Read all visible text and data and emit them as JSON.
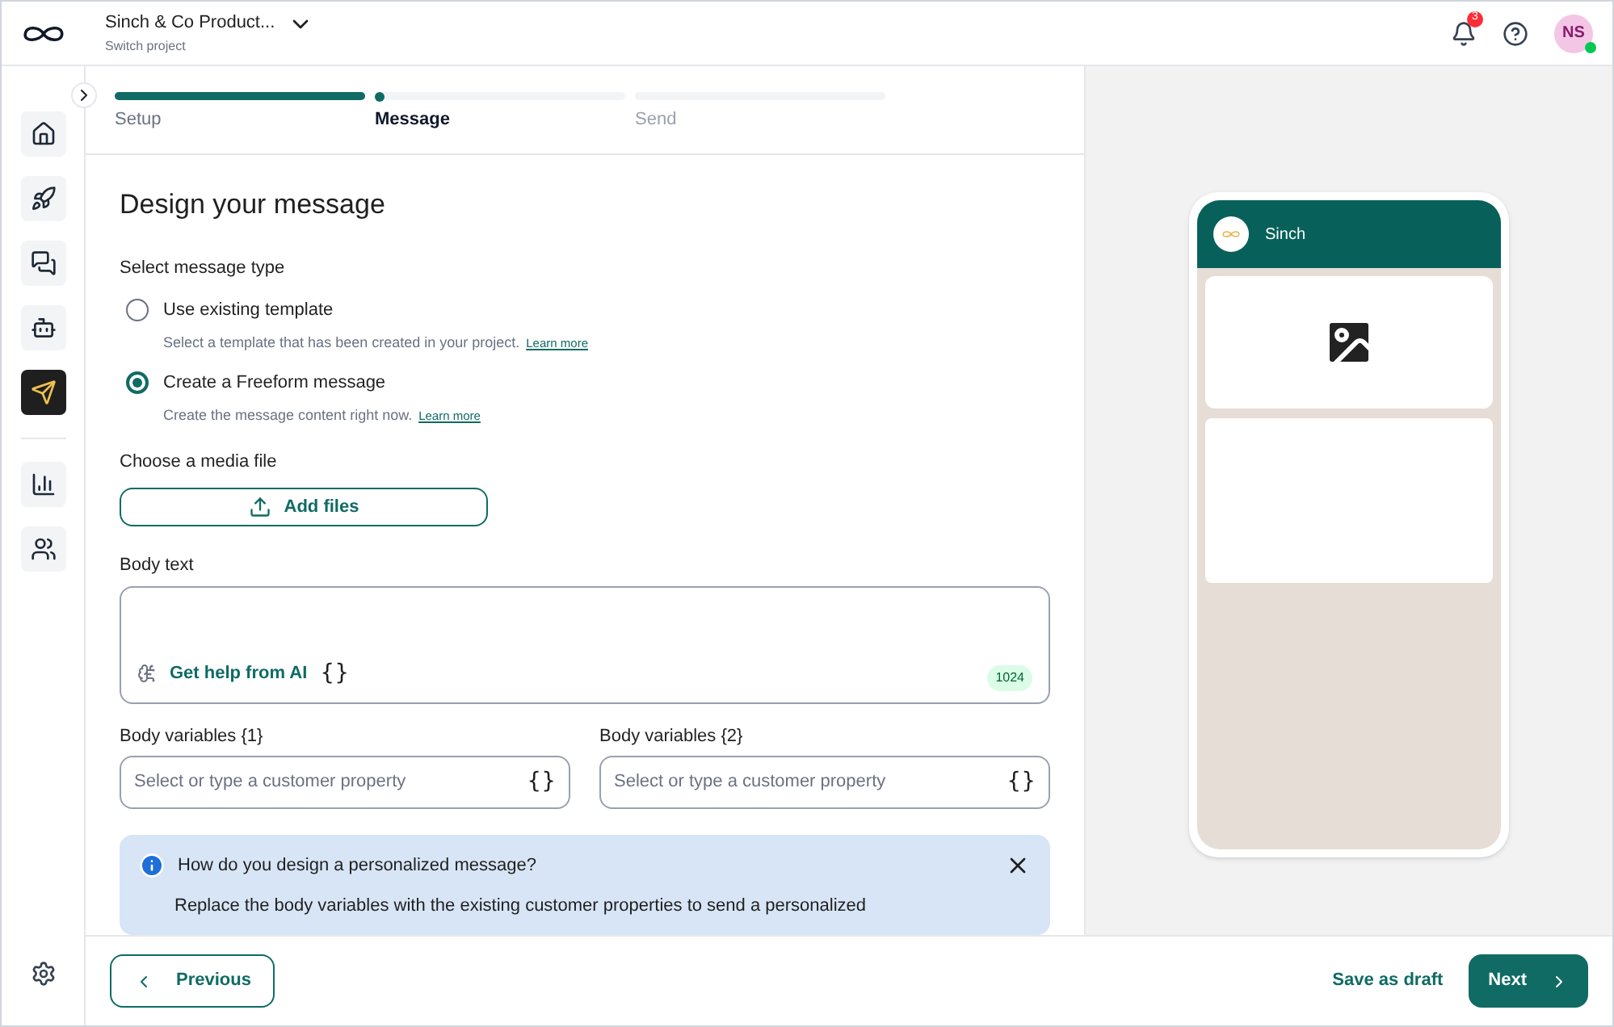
{
  "header": {
    "project": "Sinch & Co Product...",
    "subtitle": "Switch project",
    "notifications": "3",
    "avatar": "NS",
    "online": true
  },
  "sidebar": {
    "items": [
      {
        "kind": "home",
        "selected": false
      },
      {
        "kind": "rocket",
        "selected": false
      },
      {
        "kind": "chat",
        "selected": false
      },
      {
        "kind": "bot",
        "selected": false
      },
      {
        "kind": "send",
        "selected": true
      },
      {
        "kind": "divider"
      },
      {
        "kind": "chart",
        "selected": false
      },
      {
        "kind": "people",
        "selected": false
      }
    ]
  },
  "steps": [
    {
      "label": "Setup",
      "completed": true,
      "selected": false
    },
    {
      "label": "Message",
      "completed": false,
      "selected": true
    },
    {
      "label": "Send",
      "completed": false,
      "selected": false
    }
  ],
  "form": {
    "title": "Design your message",
    "type_label": "Select message type",
    "options": [
      {
        "label": "Use existing template",
        "hint": "Select a template that has been created in your project.",
        "link": "Learn more",
        "selected": false
      },
      {
        "label": "Create a Freeform message",
        "hint": "Create the message content right now.",
        "link": "Learn more",
        "selected": true
      }
    ],
    "media_label": "Choose a media file",
    "add_files": "Add files",
    "body_label": "Body text",
    "ai_help": "Get help from AI",
    "braces": "{}",
    "counter": "1024",
    "variables": [
      {
        "label": "Body variables {1}",
        "placeholder": "Select or type a customer property",
        "braces": "{}"
      },
      {
        "label": "Body variables {2}",
        "placeholder": "Select or type a customer property",
        "braces": "{}"
      }
    ],
    "info": {
      "title": "How do you design a personalized message?",
      "text": "Replace the body variables with the existing customer properties to send a personalized"
    }
  },
  "preview": {
    "sender": "Sinch"
  },
  "footer": {
    "previous": "Previous",
    "save": "Save as draft",
    "next": "Next"
  }
}
